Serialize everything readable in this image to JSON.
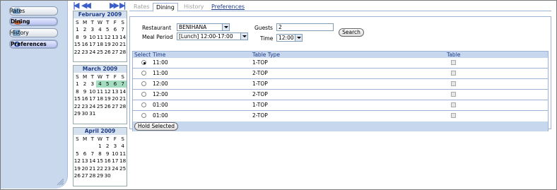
{
  "sidebar": {
    "items": [
      {
        "label": "Rates",
        "icon": "rates-icon"
      },
      {
        "label": "Dining",
        "icon": "dining-icon",
        "active": true
      },
      {
        "label": "History",
        "icon": "history-icon"
      },
      {
        "label": "Preferences",
        "icon": "preferences-icon"
      }
    ]
  },
  "calendars": [
    {
      "title": "February 2009",
      "days": [
        "S",
        "M",
        "T",
        "W",
        "T",
        "F",
        "S"
      ],
      "weeks": [
        [
          "1",
          "2",
          "3",
          "4",
          "5",
          "6",
          "7"
        ],
        [
          "8",
          "9",
          "10",
          "11",
          "12",
          "13",
          "14"
        ],
        [
          "15",
          "16",
          "17",
          "18",
          "19",
          "20",
          "21"
        ],
        [
          "22",
          "23",
          "24",
          "25",
          "26",
          "27",
          "28"
        ]
      ]
    },
    {
      "title": "March 2009",
      "days": [
        "S",
        "M",
        "T",
        "W",
        "T",
        "F",
        "S"
      ],
      "weeks": [
        [
          "1",
          "2",
          "3",
          "4",
          "5",
          "6",
          "7"
        ],
        [
          "8",
          "9",
          "10",
          "11",
          "12",
          "13",
          "14"
        ],
        [
          "15",
          "16",
          "17",
          "18",
          "19",
          "20",
          "21"
        ],
        [
          "22",
          "23",
          "24",
          "25",
          "26",
          "27",
          "28"
        ],
        [
          "29",
          "30",
          "31",
          "",
          "",
          "",
          ""
        ]
      ]
    },
    {
      "title": "April 2009",
      "days": [
        "S",
        "M",
        "T",
        "W",
        "T",
        "F",
        "S"
      ],
      "weeks": [
        [
          "",
          "",
          "",
          "1",
          "2",
          "3",
          "4"
        ],
        [
          "5",
          "6",
          "7",
          "8",
          "9",
          "10",
          "11"
        ],
        [
          "12",
          "13",
          "14",
          "15",
          "16",
          "17",
          "18"
        ],
        [
          "19",
          "20",
          "21",
          "22",
          "23",
          "24",
          "25"
        ],
        [
          "26",
          "27",
          "28",
          "29",
          "30",
          "",
          ""
        ]
      ]
    }
  ],
  "tabs": {
    "rates": "Rates",
    "dining": "Dining",
    "history": "History",
    "preferences": "Preferences"
  },
  "form": {
    "restaurant_label": "Restaurant",
    "restaurant_value": "BENIHANA",
    "meal_period_label": "Meal Period",
    "meal_period_value": "[Lunch] 12:00-17:00",
    "guests_label": "Guests",
    "guests_value": "2",
    "time_label": "Time",
    "time_value": "12:00",
    "search_label": "Search"
  },
  "grid": {
    "headers": {
      "select": "Select",
      "time": "Time",
      "table_type": "Table Type",
      "table": "Table"
    },
    "rows": [
      {
        "time": "11:00",
        "type": "1-TOP",
        "selected": true
      },
      {
        "time": "11:00",
        "type": "2-TOP",
        "selected": false
      },
      {
        "time": "12:00",
        "type": "1-TOP",
        "selected": false
      },
      {
        "time": "12:00",
        "type": "2-TOP",
        "selected": false
      },
      {
        "time": "01:00",
        "type": "1-TOP",
        "selected": false
      },
      {
        "time": "01:00",
        "type": "2-TOP",
        "selected": false
      }
    ],
    "hold_label": "Hold Selected"
  },
  "colors": {
    "accent": "#1f3c88",
    "sidebar": "#c9d8ec",
    "highlight": "#a4dcc0"
  }
}
